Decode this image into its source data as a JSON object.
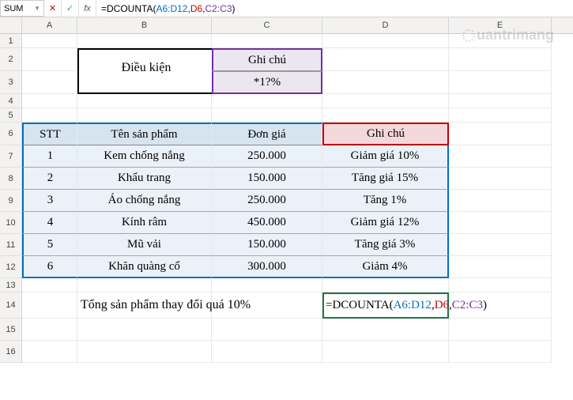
{
  "nameBox": "SUM",
  "formula": {
    "prefix": "=DCOUNTA(",
    "range1": "A6:D12",
    "range2": "D6",
    "range3": "C2:C3",
    "suffix": ")"
  },
  "columns": [
    "A",
    "B",
    "C",
    "D",
    "E"
  ],
  "rowNumbers": [
    1,
    2,
    3,
    4,
    5,
    6,
    7,
    8,
    9,
    10,
    11,
    12,
    13,
    14,
    15,
    16
  ],
  "condition": {
    "label": "Điều kiện",
    "header": "Ghi chú",
    "value": "*1?%"
  },
  "table": {
    "headers": {
      "stt": "STT",
      "ten": "Tên sản phẩm",
      "don": "Đơn giá",
      "ghi": "Ghi chú"
    },
    "rows": [
      {
        "stt": "1",
        "ten": "Kem chống nắng",
        "don": "250.000",
        "ghi": "Giảm giá 10%"
      },
      {
        "stt": "2",
        "ten": "Khẩu trang",
        "don": "150.000",
        "ghi": "Tăng giá 15%"
      },
      {
        "stt": "3",
        "ten": "Áo chống nắng",
        "don": "250.000",
        "ghi": "Tăng 1%"
      },
      {
        "stt": "4",
        "ten": "Kính râm",
        "don": "450.000",
        "ghi": "Giảm giá 12%"
      },
      {
        "stt": "5",
        "ten": "Mũ vải",
        "don": "150.000",
        "ghi": "Tăng giá 3%"
      },
      {
        "stt": "6",
        "ten": "Khăn quàng cổ",
        "don": "300.000",
        "ghi": "Giảm 4%"
      }
    ]
  },
  "summary": "Tổng sản phẩm thay đổi quá 10%",
  "watermark": "uantrimang",
  "rowHeights": {
    "short": 18,
    "normal": 28
  }
}
